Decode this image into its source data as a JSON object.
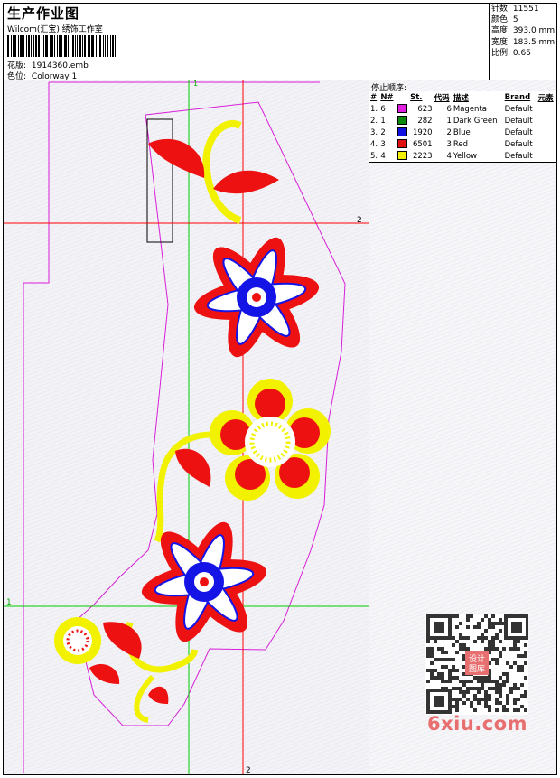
{
  "header": {
    "title": "生产作业图",
    "company": "Wilcom(汇宝) 绣饰工作室",
    "design_label": "花版:",
    "design_value": "1914360.emb",
    "colorway_label": "色位:",
    "colorway_value": "Colorway 1"
  },
  "stats": [
    {
      "label": "针数:",
      "value": "11551"
    },
    {
      "label": "颜色:",
      "value": "5"
    },
    {
      "label": "高度:",
      "value": "393.0 mm"
    },
    {
      "label": "宽度:",
      "value": "183.5 mm"
    },
    {
      "label": "比例:",
      "value": "0.65"
    }
  ],
  "stop_sequence": {
    "heading": "停止顺序:",
    "columns": [
      "#",
      "N#",
      "St.",
      "代码",
      "描述",
      "Brand",
      "元素"
    ],
    "rows": [
      {
        "num": "1.",
        "n": "6",
        "color": "#e020e0",
        "st": "623",
        "code": "6",
        "desc": "Magenta",
        "brand": "Default"
      },
      {
        "num": "2.",
        "n": "1",
        "color": "#0a8a0a",
        "st": "282",
        "code": "1",
        "desc": "Dark Green",
        "brand": "Default"
      },
      {
        "num": "3.",
        "n": "2",
        "color": "#1010e0",
        "st": "1920",
        "code": "2",
        "desc": "Blue",
        "brand": "Default"
      },
      {
        "num": "4.",
        "n": "3",
        "color": "#e01010",
        "st": "6501",
        "code": "3",
        "desc": "Red",
        "brand": "Default"
      },
      {
        "num": "5.",
        "n": "4",
        "color": "#f0f000",
        "st": "2223",
        "code": "4",
        "desc": "Yellow",
        "brand": "Default"
      }
    ]
  },
  "guides": {
    "top_label": "1",
    "right_label": "2",
    "left_label": "1",
    "bottom_label": "2"
  },
  "watermark": "6xiu.com",
  "qr_badge": "设计\n图库",
  "colors": {
    "outline": "#d81ed8",
    "guide_green": "#00cc00",
    "guide_red": "#ff0000",
    "red": "#ee1111",
    "blue": "#1414e6",
    "yellow": "#f2f200"
  }
}
